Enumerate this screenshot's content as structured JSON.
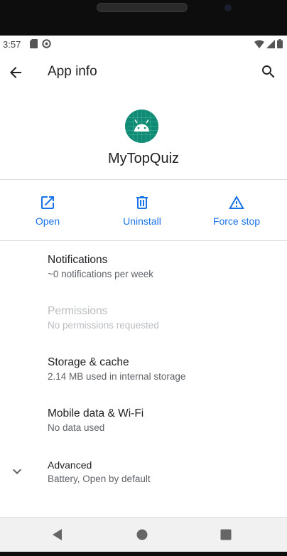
{
  "status_bar": {
    "time": "3:57"
  },
  "app_bar": {
    "title": "App info"
  },
  "header": {
    "app_name": "MyTopQuiz"
  },
  "actions": {
    "open_label": "Open",
    "uninstall_label": "Uninstall",
    "force_stop_label": "Force stop"
  },
  "settings": {
    "notifications": {
      "title": "Notifications",
      "summary": "~0 notifications per week"
    },
    "permissions": {
      "title": "Permissions",
      "summary": "No permissions requested"
    },
    "storage": {
      "title": "Storage & cache",
      "summary": "2.14 MB used in internal storage"
    },
    "mobile_data": {
      "title": "Mobile data & Wi-Fi",
      "summary": "No data used"
    },
    "advanced": {
      "title": "Advanced",
      "summary": "Battery, Open by default"
    }
  },
  "colors": {
    "accent": "#1a73e8",
    "app_icon_bg": "#0f8a74"
  }
}
